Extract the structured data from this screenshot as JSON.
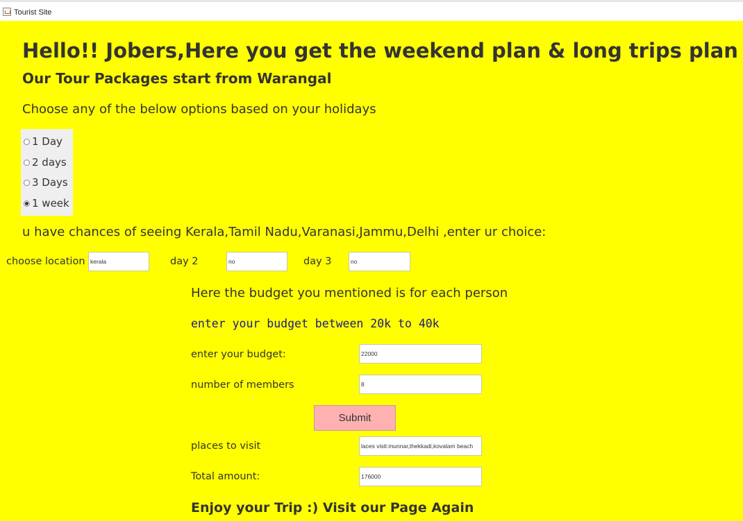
{
  "window": {
    "title": "Tourist Site"
  },
  "header": {
    "title": "Hello!! Jobers,Here you get the weekend plan & long trips plan",
    "subtitle": "Our Tour Packages start from  Warangal"
  },
  "intro_text": "Choose any of the below options based on your holidays",
  "duration_options": [
    {
      "label": "1 Day",
      "selected": false
    },
    {
      "label": "2 days",
      "selected": false
    },
    {
      "label": "3 Days",
      "selected": false
    },
    {
      "label": "1 week",
      "selected": true
    }
  ],
  "locations_text": "u have chances of seeing Kerala,Tamil Nadu,Varanasi,Jammu,Delhi ,enter ur choice:",
  "location_row": {
    "choose_label": "choose location",
    "choose_value": "kerala",
    "day2_label": "day 2",
    "day2_value": "no",
    "day3_label": "day 3",
    "day3_value": "no"
  },
  "budget": {
    "note": "Here the budget you mentioned is for each person",
    "range_text": "enter your  budget between 20k to 40k",
    "budget_label": "enter your budget:",
    "budget_value": "22000",
    "members_label": "number of members",
    "members_value": "8"
  },
  "submit_label": "Submit",
  "results": {
    "places_label": "places to visit",
    "places_value": "laces visit:munnar,thekkadi,kovalam beach",
    "total_label": "Total amount:",
    "total_value": "176000"
  },
  "footer_text": "Enjoy your Trip :) Visit our Page Again",
  "colors": {
    "background": "#ffff00",
    "button": "#ffb0b0",
    "mono_text": "#1a1a80"
  }
}
